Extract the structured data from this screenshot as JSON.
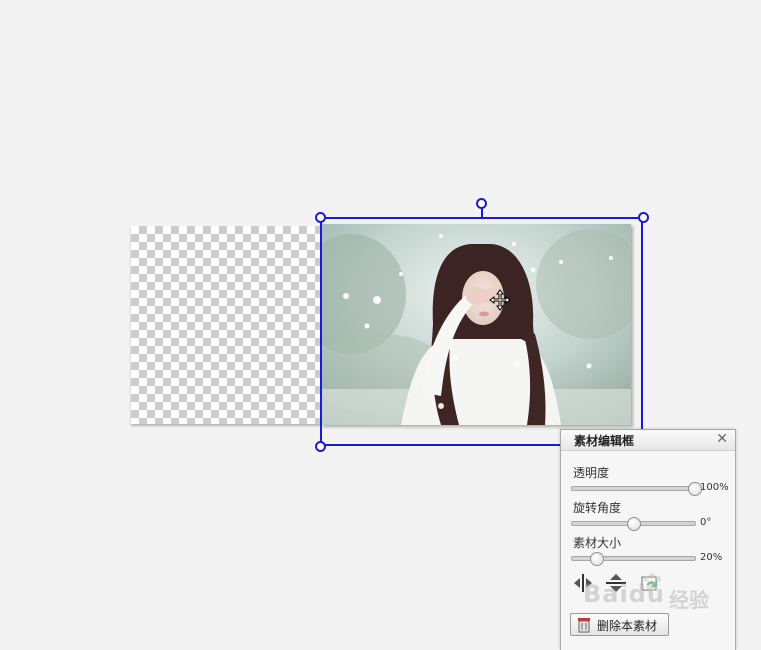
{
  "canvas": {
    "selection_color": "#1a1adb"
  },
  "panel": {
    "title": "素材编辑框",
    "close_symbol": "✕",
    "sliders": [
      {
        "label": "透明度",
        "value": 100,
        "value_text": "100%"
      },
      {
        "label": "旋转角度",
        "value": 50,
        "value_text": "0°"
      },
      {
        "label": "素材大小",
        "value": 20,
        "value_text": "20%"
      }
    ],
    "tools": [
      {
        "icon": "flip-horizontal-icon"
      },
      {
        "icon": "flip-vertical-icon"
      },
      {
        "icon": "reset-icon"
      }
    ],
    "delete_label": "删除本素材"
  },
  "watermark": {
    "brand": "Baidu",
    "suffix": "经验"
  }
}
